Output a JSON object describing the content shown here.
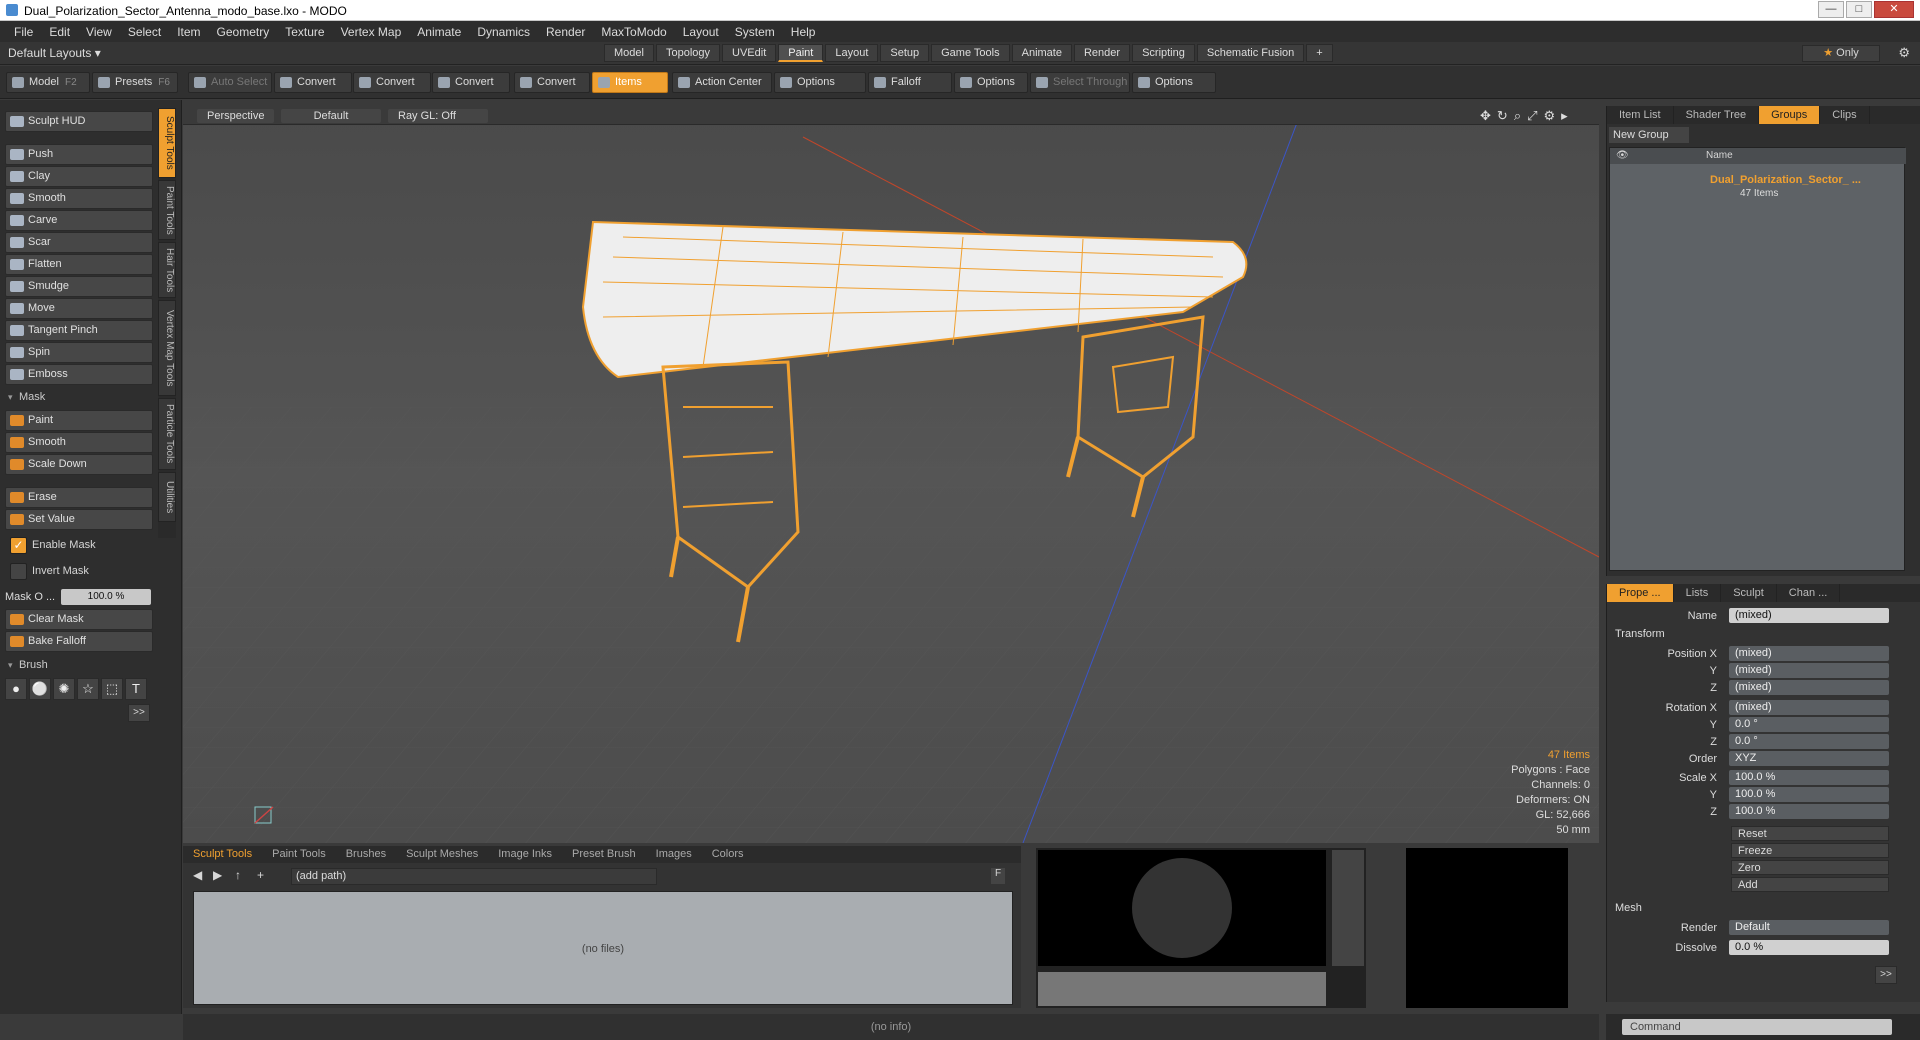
{
  "window": {
    "title": "Dual_Polarization_Sector_Antenna_modo_base.lxo - MODO",
    "min": "—",
    "max": "□",
    "close": "✕"
  },
  "menu": [
    "File",
    "Edit",
    "View",
    "Select",
    "Item",
    "Geometry",
    "Texture",
    "Vertex Map",
    "Animate",
    "Dynamics",
    "Render",
    "MaxToModo",
    "Layout",
    "System",
    "Help"
  ],
  "layout": {
    "default_layouts": "Default Layouts ▾",
    "tabs": [
      "Model",
      "Topology",
      "UVEdit",
      "Paint",
      "Layout",
      "Setup",
      "Game Tools",
      "Animate",
      "Render",
      "Scripting",
      "Schematic Fusion"
    ],
    "active_tab": "Paint",
    "plus": "+",
    "only": "Only"
  },
  "toolbar": {
    "model": "Model",
    "model_key": "F2",
    "presets": "Presets",
    "presets_key": "F6",
    "auto_select": "Auto Select",
    "convert1": "Convert",
    "convert2": "Convert",
    "convert3": "Convert",
    "convert4": "Convert",
    "items": "Items",
    "action_center": "Action Center",
    "options1": "Options",
    "falloff": "Falloff",
    "options2": "Options",
    "select_through": "Select Through",
    "options3": "Options"
  },
  "left": {
    "sculpt_hud": "Sculpt HUD",
    "tools": [
      "Push",
      "Clay",
      "Smooth",
      "Carve",
      "Scar",
      "Flatten",
      "Smudge",
      "Move",
      "Tangent Pinch",
      "Spin",
      "Emboss"
    ],
    "mask_section": "Mask",
    "mask_tools": [
      "Paint",
      "Smooth",
      "Scale Down"
    ],
    "erase": "Erase",
    "set_value": "Set Value",
    "enable_mask": "Enable Mask",
    "invert_mask": "Invert Mask",
    "mask_opacity_label": "Mask O ...",
    "mask_opacity_value": "100.0 %",
    "clear_mask": "Clear Mask",
    "bake_falloff": "Bake Falloff",
    "brush_section": "Brush",
    "more": ">>",
    "vtabs": [
      "Sculpt Tools",
      "Paint Tools",
      "Hair Tools",
      "Vertex Map Tools",
      "Particle Tools",
      "Utilities"
    ]
  },
  "viewport": {
    "view": "Perspective",
    "style": "Default",
    "raygl": "Ray GL: Off",
    "info": {
      "items": "47 Items",
      "polygons": "Polygons : Face",
      "channels": "Channels: 0",
      "deformers": "Deformers: ON",
      "gl": "GL: 52,666",
      "scale": "50 mm"
    }
  },
  "right_top": {
    "tabs": [
      "Item List",
      "Shader Tree",
      "Groups",
      "Clips"
    ],
    "active": "Groups",
    "new_group": "New Group",
    "col_name": "Name",
    "group_name": "Dual_Polarization_Sector_ ...",
    "group_count": "47 Items"
  },
  "right_bottom": {
    "tabs": [
      "Prope ...",
      "Lists",
      "Sculpt",
      "Chan ..."
    ],
    "name_label": "Name",
    "name_value": "(mixed)",
    "transform": "Transform",
    "pos_x_label": "Position X",
    "pos_x": "(mixed)",
    "pos_y_label": "Y",
    "pos_y": "(mixed)",
    "pos_z_label": "Z",
    "pos_z": "(mixed)",
    "rot_x_label": "Rotation X",
    "rot_x": "(mixed)",
    "rot_y_label": "Y",
    "rot_y": "0.0 °",
    "rot_z_label": "Z",
    "rot_z": "0.0 °",
    "order_label": "Order",
    "order": "XYZ",
    "scale_x_label": "Scale X",
    "scale_x": "100.0 %",
    "scale_y_label": "Y",
    "scale_y": "100.0 %",
    "scale_z_label": "Z",
    "scale_z": "100.0 %",
    "reset": "Reset",
    "freeze": "Freeze",
    "zero": "Zero",
    "add": "Add",
    "mesh": "Mesh",
    "render_label": "Render",
    "render": "Default",
    "dissolve_label": "Dissolve",
    "dissolve": "0.0 %",
    "more": ">>"
  },
  "bottom": {
    "tabs": [
      "Sculpt Tools",
      "Paint Tools",
      "Brushes",
      "Sculpt Meshes",
      "Image Inks",
      "Preset Brush",
      "Images",
      "Colors"
    ],
    "active": "Sculpt Tools",
    "path": "(add path)",
    "no_files": "(no files)",
    "f_label": "F"
  },
  "status": {
    "info": "(no info)",
    "command_placeholder": "Command"
  },
  "colors": {
    "accent": "#f0a030",
    "wire": "#f0a030",
    "bg": "#3a3a3a"
  }
}
